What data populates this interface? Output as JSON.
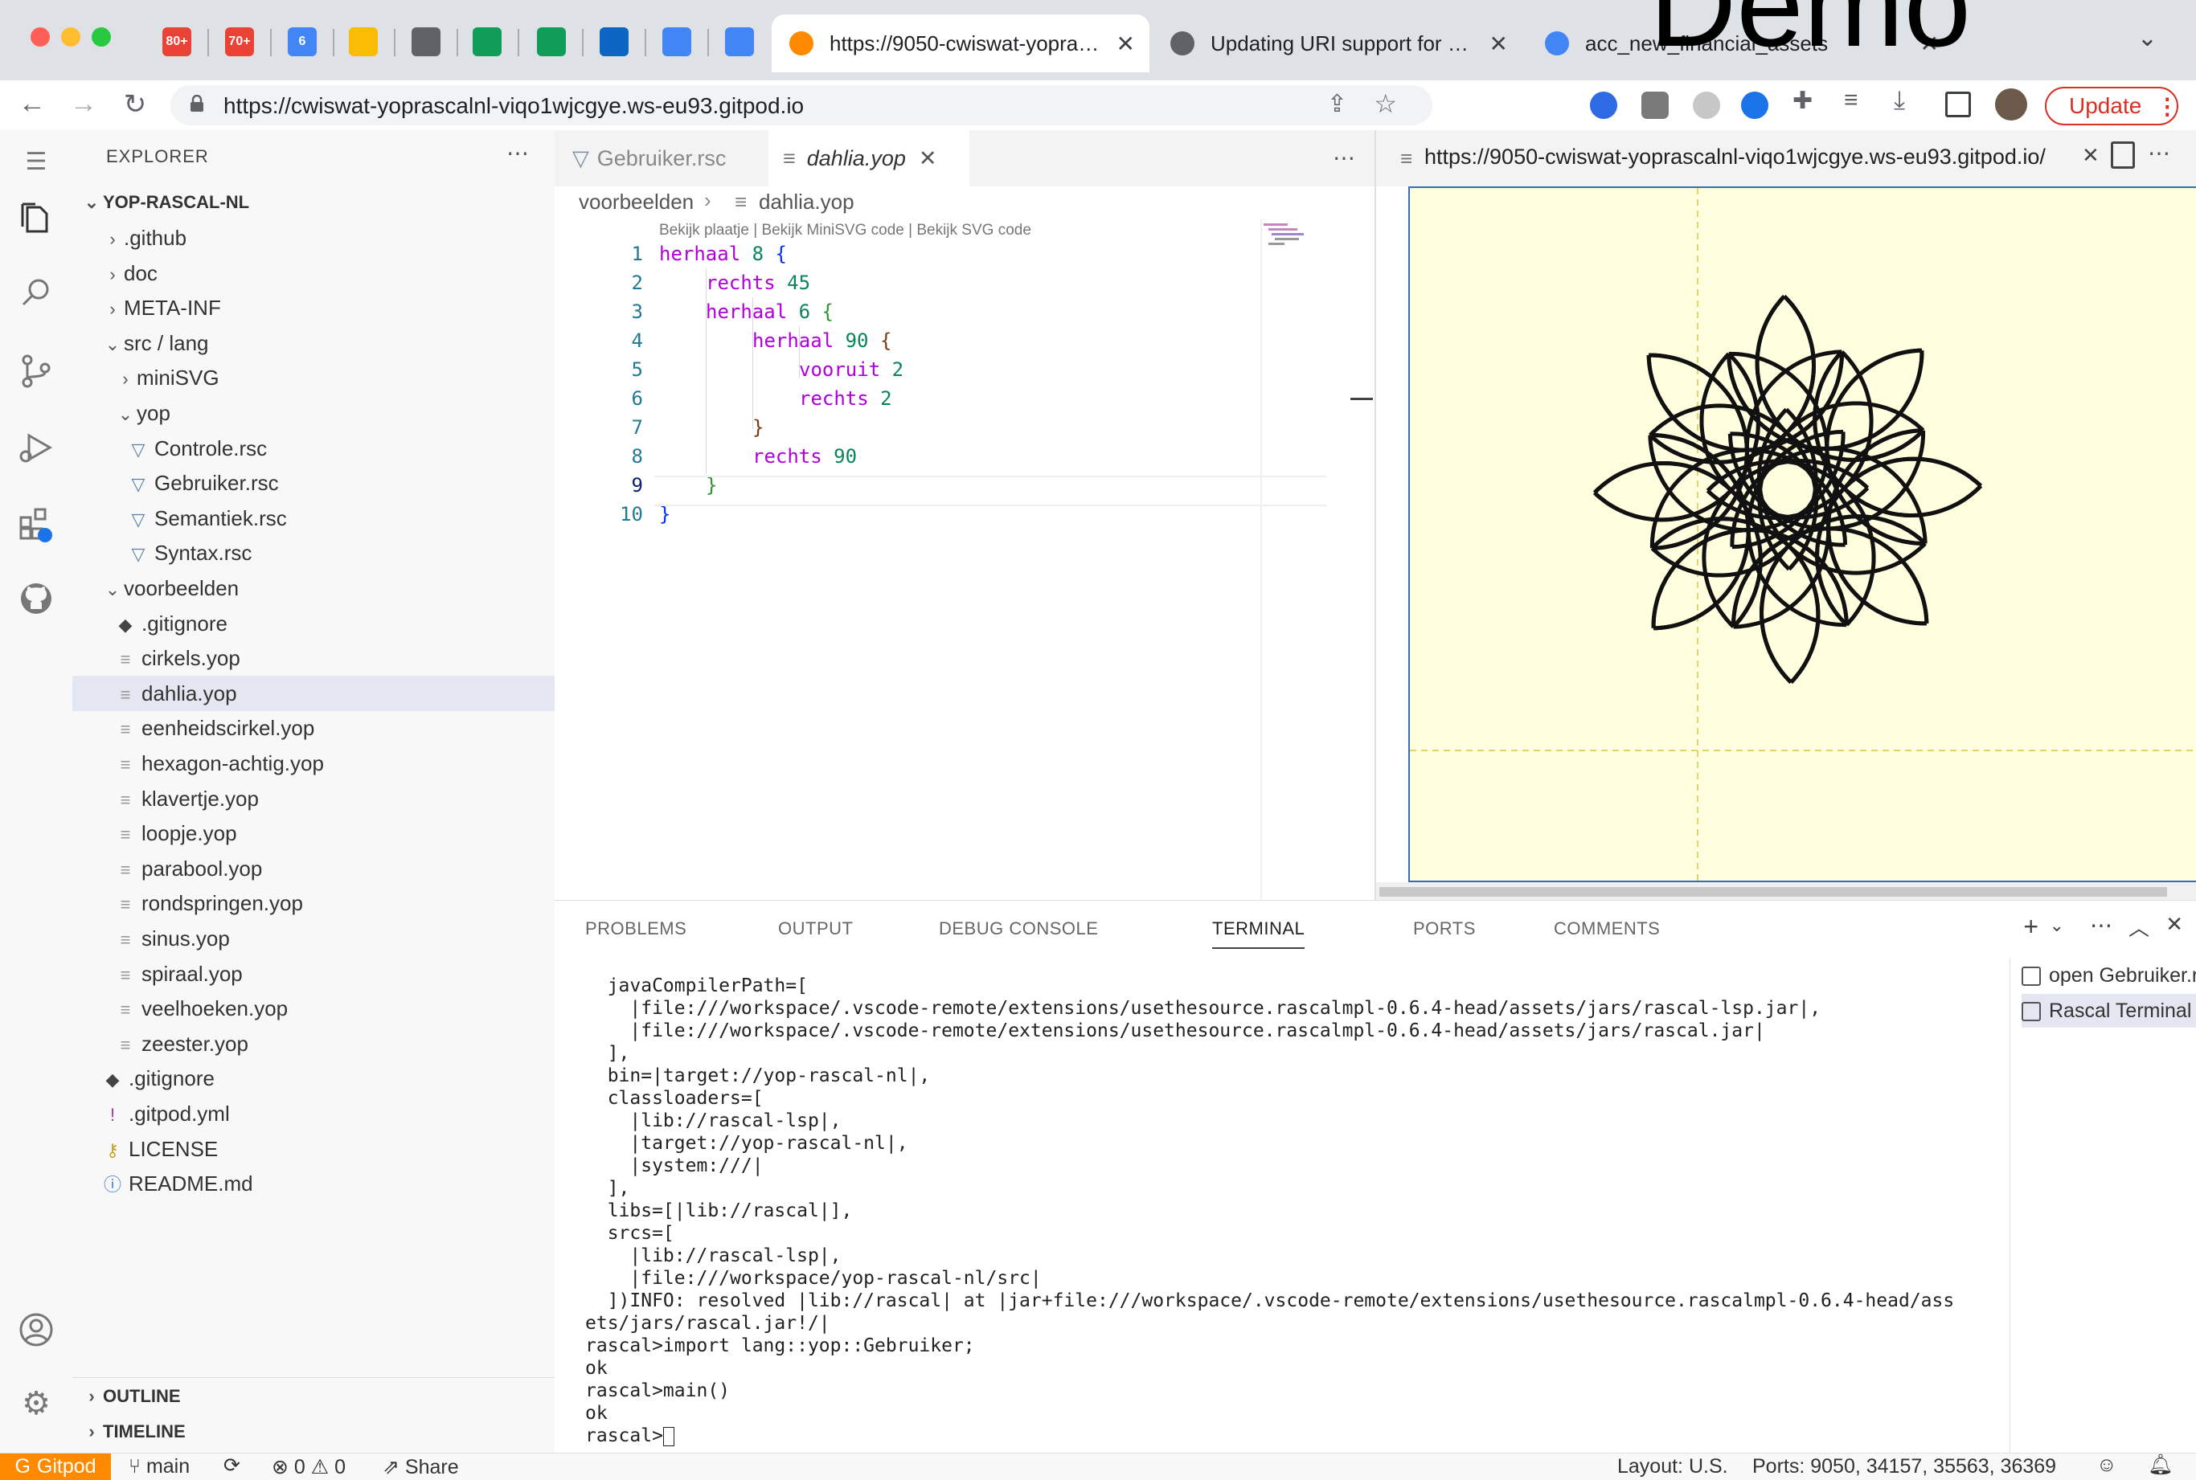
{
  "browser": {
    "pinned_tabs": [
      {
        "icon": "gmail-icon",
        "badge": "80+",
        "color": "#ea4335"
      },
      {
        "icon": "gmail-icon",
        "badge": "70+",
        "color": "#ea4335"
      },
      {
        "icon": "calendar-icon",
        "badge": "6",
        "color": "#4285f4"
      },
      {
        "icon": "drive-icon",
        "badge": "",
        "color": "#fbbc04"
      },
      {
        "icon": "globe-icon",
        "badge": "",
        "color": "#5f6368"
      },
      {
        "icon": "sheets-icon",
        "badge": "",
        "color": "#0f9d58"
      },
      {
        "icon": "sheets-icon",
        "badge": "",
        "color": "#0f9d58"
      },
      {
        "icon": "linkedin-icon",
        "badge": "",
        "color": "#0a66c2"
      },
      {
        "icon": "docs-icon",
        "badge": "",
        "color": "#4285f4"
      },
      {
        "icon": "docs-icon",
        "badge": "",
        "color": "#4285f4"
      }
    ],
    "tabs": [
      {
        "title": "https://9050-cwiswat-yoprascalnl-viqo1wjcgye.ws-eu93.gitpod.io/",
        "active": true
      },
      {
        "title": "Updating URI support for RFC 3986",
        "active": false
      },
      {
        "title": "acc_new_financial_assets",
        "active": false
      }
    ],
    "overlay_text": "Demo",
    "url": "https://cwiswat-yoprascalnl-viqo1wjcgye.ws-eu93.gitpod.io",
    "update_label": "Update"
  },
  "explorer": {
    "header": "EXPLORER",
    "root": "YOP-RASCAL-NL",
    "items": [
      {
        "label": ".github",
        "type": "folder",
        "open": false,
        "depth": 1
      },
      {
        "label": "doc",
        "type": "folder",
        "open": false,
        "depth": 1
      },
      {
        "label": "META-INF",
        "type": "folder",
        "open": false,
        "depth": 1
      },
      {
        "label": "src / lang",
        "type": "folder",
        "open": true,
        "depth": 1
      },
      {
        "label": "miniSVG",
        "type": "folder",
        "open": false,
        "depth": 2
      },
      {
        "label": "yop",
        "type": "folder",
        "open": true,
        "depth": 2
      },
      {
        "label": "Controle.rsc",
        "type": "rsc",
        "depth": 3
      },
      {
        "label": "Gebruiker.rsc",
        "type": "rsc",
        "depth": 3
      },
      {
        "label": "Semantiek.rsc",
        "type": "rsc",
        "depth": 3
      },
      {
        "label": "Syntax.rsc",
        "type": "rsc",
        "depth": 3
      },
      {
        "label": "voorbeelden",
        "type": "folder",
        "open": true,
        "depth": 1
      },
      {
        "label": ".gitignore",
        "type": "git",
        "depth": 2
      },
      {
        "label": "cirkels.yop",
        "type": "file",
        "depth": 2
      },
      {
        "label": "dahlia.yop",
        "type": "file",
        "depth": 2,
        "selected": true
      },
      {
        "label": "eenheidscirkel.yop",
        "type": "file",
        "depth": 2
      },
      {
        "label": "hexagon-achtig.yop",
        "type": "file",
        "depth": 2
      },
      {
        "label": "klavertje.yop",
        "type": "file",
        "depth": 2
      },
      {
        "label": "loopje.yop",
        "type": "file",
        "depth": 2
      },
      {
        "label": "parabool.yop",
        "type": "file",
        "depth": 2
      },
      {
        "label": "rondspringen.yop",
        "type": "file",
        "depth": 2
      },
      {
        "label": "sinus.yop",
        "type": "file",
        "depth": 2
      },
      {
        "label": "spiraal.yop",
        "type": "file",
        "depth": 2
      },
      {
        "label": "veelhoeken.yop",
        "type": "file",
        "depth": 2
      },
      {
        "label": "zeester.yop",
        "type": "file",
        "depth": 2
      },
      {
        "label": ".gitignore",
        "type": "git",
        "depth": 1
      },
      {
        "label": ".gitpod.yml",
        "type": "yml",
        "depth": 1
      },
      {
        "label": "LICENSE",
        "type": "license",
        "depth": 1
      },
      {
        "label": "README.md",
        "type": "info",
        "depth": 1
      }
    ],
    "outline": "OUTLINE",
    "timeline": "TIMELINE"
  },
  "editor": {
    "tabs": [
      {
        "label": "Gebruiker.rsc",
        "active": false
      },
      {
        "label": "dahlia.yop",
        "active": true
      }
    ],
    "breadcrumb": [
      "voorbeelden",
      "dahlia.yop"
    ],
    "codelens": "Bekijk plaatje | Bekijk MiniSVG code | Bekijk SVG code",
    "lines": [
      {
        "n": "1",
        "indent": 0,
        "kw": "herhaal",
        "num": "8",
        "tail": "{",
        "bc": "br1"
      },
      {
        "n": "2",
        "indent": 1,
        "kw": "rechts",
        "num": "45",
        "tail": "",
        "bc": ""
      },
      {
        "n": "3",
        "indent": 1,
        "kw": "herhaal",
        "num": "6",
        "tail": "{",
        "bc": "br2"
      },
      {
        "n": "4",
        "indent": 2,
        "kw": "herhaal",
        "num": "90",
        "tail": "{",
        "bc": "br3"
      },
      {
        "n": "5",
        "indent": 3,
        "kw": "vooruit",
        "num": "2",
        "tail": "",
        "bc": ""
      },
      {
        "n": "6",
        "indent": 3,
        "kw": "rechts",
        "num": "2",
        "tail": "",
        "bc": ""
      },
      {
        "n": "7",
        "indent": 2,
        "kw": "",
        "num": "",
        "tail": "}",
        "bc": "br3"
      },
      {
        "n": "8",
        "indent": 2,
        "kw": "rechts",
        "num": "90",
        "tail": "",
        "bc": ""
      },
      {
        "n": "9",
        "indent": 1,
        "kw": "",
        "num": "",
        "tail": "}",
        "bc": "br2"
      },
      {
        "n": "10",
        "indent": 0,
        "kw": "",
        "num": "",
        "tail": "}",
        "bc": "br1"
      }
    ]
  },
  "preview": {
    "tab_title": "https://9050-cwiswat-yoprascalnl-viqo1wjcgye.ws-eu93.gitpod.io/",
    "drawing": {
      "outer_repeat": 8,
      "outer_turn": 45,
      "inner_repeat": 6,
      "arc_steps": 90,
      "step": 2,
      "arc_turn": 2,
      "inner_turn": 90
    }
  },
  "panel": {
    "tabs": [
      "PROBLEMS",
      "OUTPUT",
      "DEBUG CONSOLE",
      "TERMINAL",
      "PORTS",
      "COMMENTS"
    ],
    "active_tab": "TERMINAL",
    "terminal_lines": [
      "  javaCompilerPath=[",
      "    |file:///workspace/.vscode-remote/extensions/usethesource.rascalmpl-0.6.4-head/assets/jars/rascal-lsp.jar|,",
      "    |file:///workspace/.vscode-remote/extensions/usethesource.rascalmpl-0.6.4-head/assets/jars/rascal.jar|",
      "  ],",
      "  bin=|target://yop-rascal-nl|,",
      "  classloaders=[",
      "    |lib://rascal-lsp|,",
      "    |target://yop-rascal-nl|,",
      "    |system:///|",
      "  ],",
      "  libs=[|lib://rascal|],",
      "  srcs=[",
      "    |lib://rascal-lsp|,",
      "    |file:///workspace/yop-rascal-nl/src|",
      "  ])INFO: resolved |lib://rascal| at |jar+file:///workspace/.vscode-remote/extensions/usethesource.rascalmpl-0.6.4-head/ass",
      "ets/jars/rascal.jar!/|",
      "rascal>import lang::yop::Gebruiker;",
      "ok",
      "rascal>main()",
      "ok",
      "rascal>"
    ],
    "terminals": [
      {
        "label": "open Gebruiker.rsc",
        "selected": false
      },
      {
        "label": "Rascal Terminal",
        "selected": true
      }
    ]
  },
  "statusbar": {
    "brand": "Gitpod",
    "branch": "main",
    "errors": "0",
    "warnings": "0",
    "share": "Share",
    "layout": "Layout: U.S.",
    "ports": "Ports: 9050, 34157, 35563, 36369"
  }
}
